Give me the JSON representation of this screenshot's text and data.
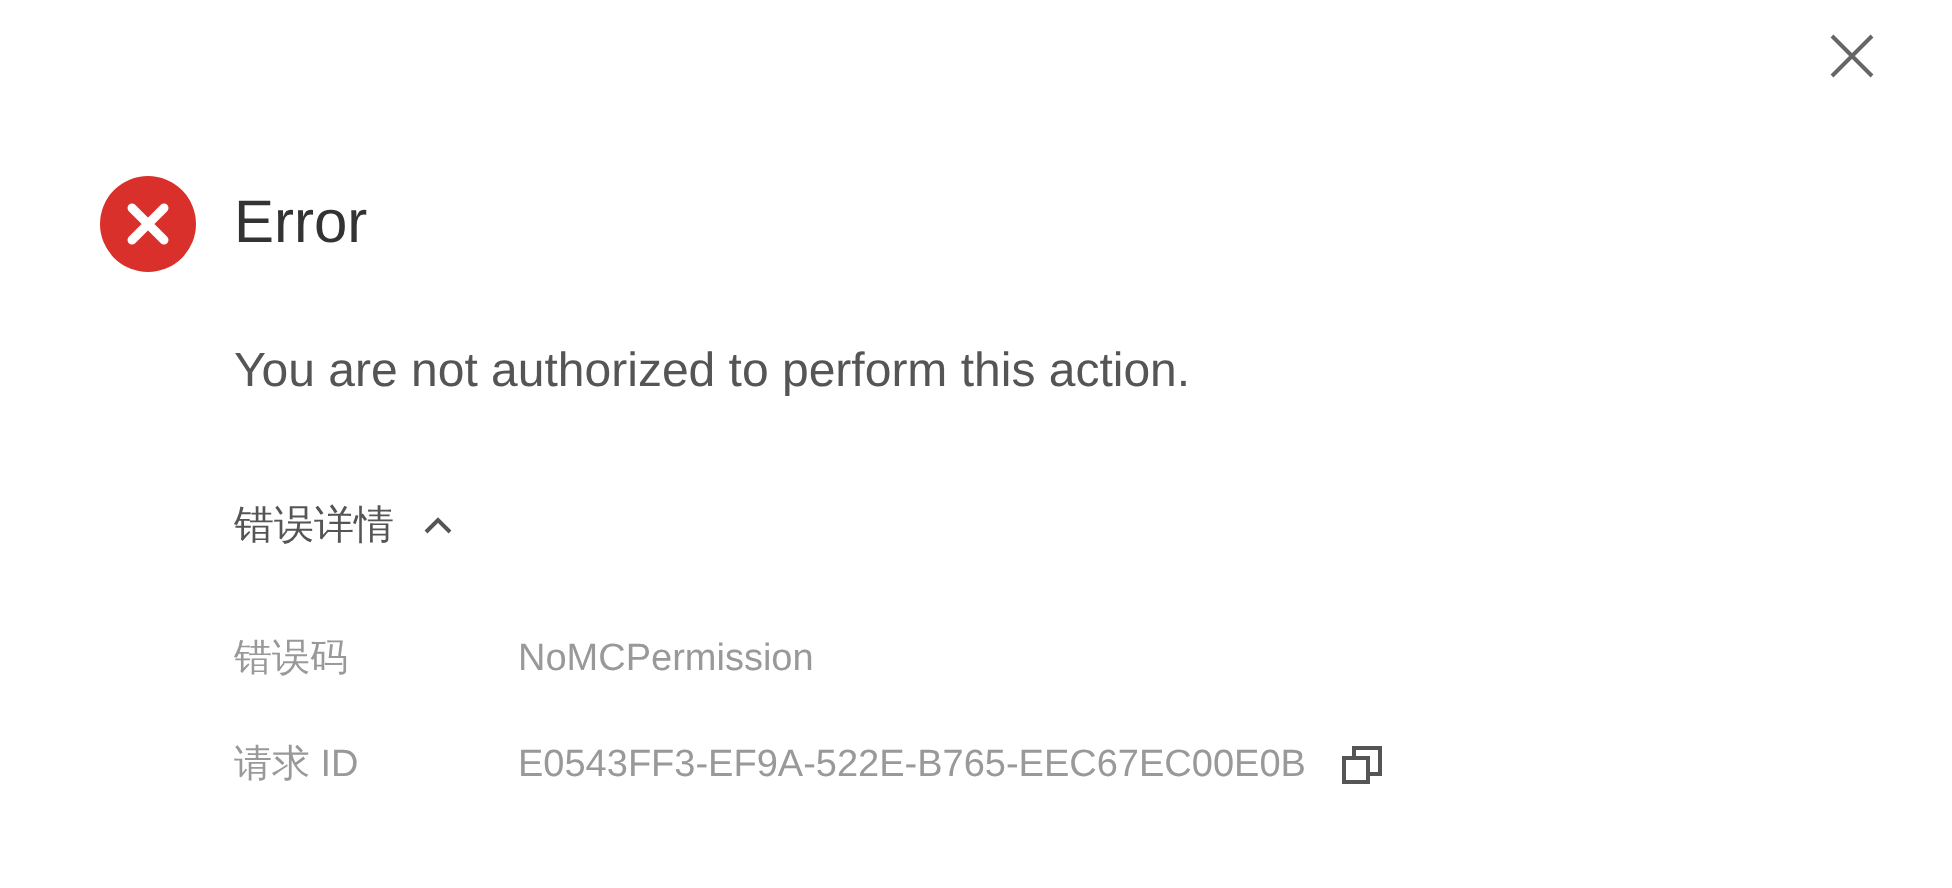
{
  "dialog": {
    "title": "Error",
    "message": "You are not authorized to perform this action.",
    "details": {
      "label": "错误详情",
      "expanded": true,
      "rows": [
        {
          "label": "错误码",
          "value": "NoMCPermission",
          "copyable": false
        },
        {
          "label": "请求 ID",
          "value": "E0543FF3-EF9A-522E-B765-EEC67EC00E0B",
          "copyable": true
        }
      ]
    }
  }
}
